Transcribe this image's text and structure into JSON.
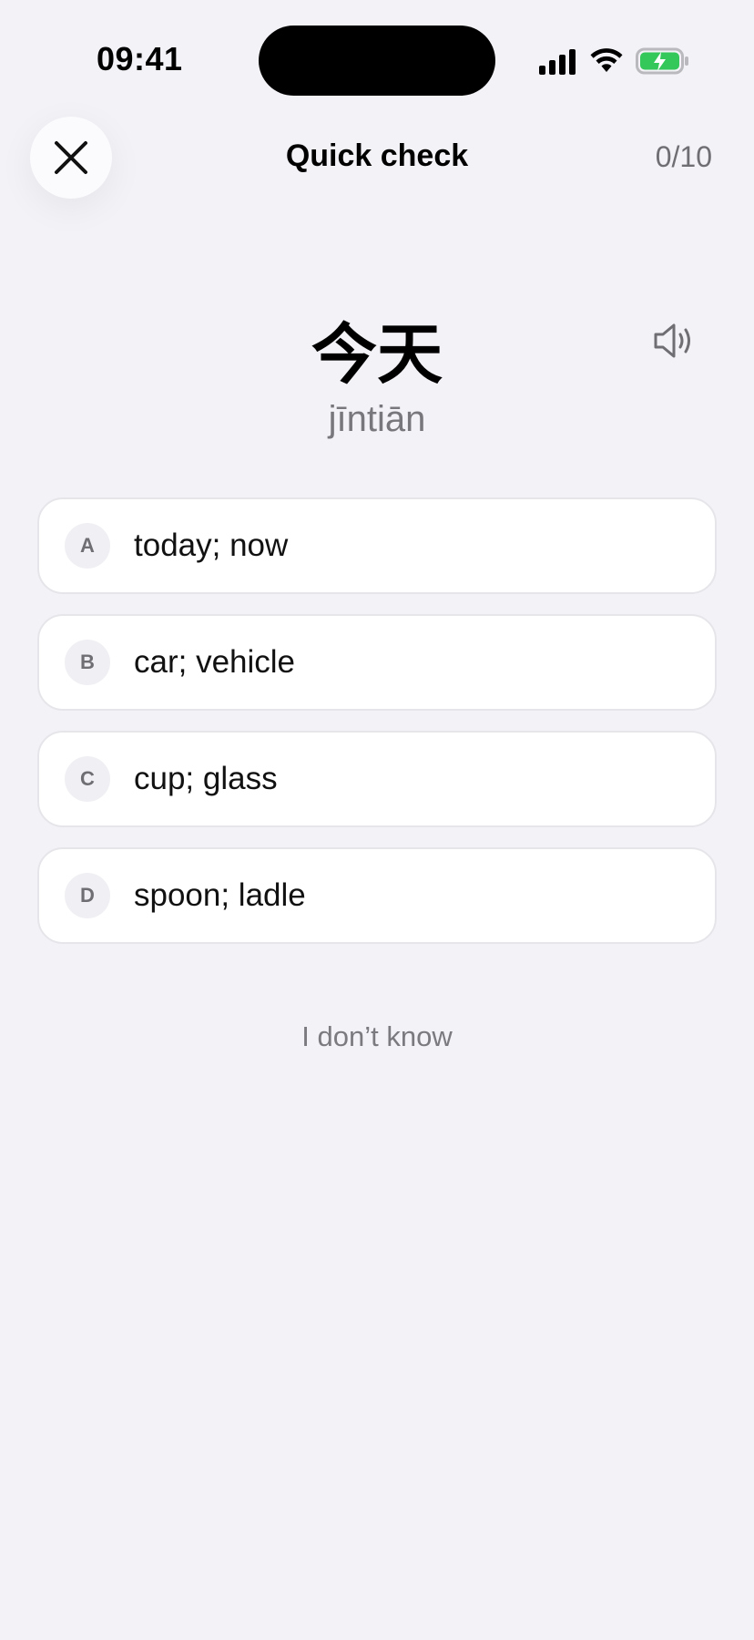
{
  "status_bar": {
    "time": "09:41",
    "battery_color": "#34c759"
  },
  "header": {
    "title": "Quick check",
    "progress": "0/10",
    "close_icon": "close-icon"
  },
  "word": {
    "hanzi": "今天",
    "pinyin": "jīntiān",
    "audio_icon": "speaker-icon"
  },
  "options": [
    {
      "letter": "A",
      "text": "today; now"
    },
    {
      "letter": "B",
      "text": "car; vehicle"
    },
    {
      "letter": "C",
      "text": "cup; glass"
    },
    {
      "letter": "D",
      "text": "spoon; ladle"
    }
  ],
  "skip_label": "I don’t know"
}
